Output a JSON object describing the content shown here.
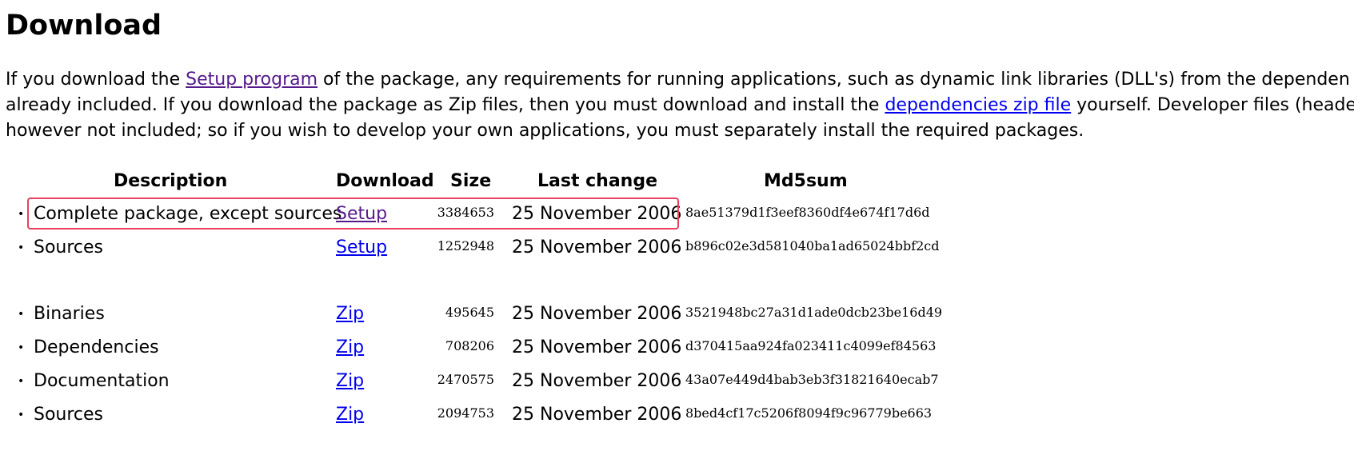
{
  "page": {
    "title": "Download",
    "intro": {
      "line1_before": "If you download the ",
      "setup_link": "Setup program",
      "line1_after": " of the package, any requirements for running applications, such as dynamic link libraries (DLL's) from the dependen",
      "line2_before": "already included. If you download the package as Zip files, then you must download and install the ",
      "deps_link": "dependencies zip file",
      "line2_after": " yourself. Developer files (heade",
      "line3": "however not included; so if you wish to develop your own applications, you must separately install the required packages."
    }
  },
  "table": {
    "headers": {
      "description": "Description",
      "download": "Download",
      "size": "Size",
      "last_change": "Last change",
      "md5sum": "Md5sum"
    },
    "bullet": "•",
    "rows": [
      {
        "description": "Complete package, except sources",
        "download": "Setup",
        "download_visited": true,
        "size": "3384653",
        "last_change": "25 November 2006",
        "md5sum": "8ae51379d1f3eef8360df4e674f17d6d",
        "highlighted": true
      },
      {
        "description": "Sources",
        "download": "Setup",
        "download_visited": false,
        "size": "1252948",
        "last_change": "25 November 2006",
        "md5sum": "b896c02e3d581040ba1ad65024bbf2cd",
        "highlighted": false
      },
      {
        "description": "Binaries",
        "download": "Zip",
        "download_visited": false,
        "size": "495645",
        "last_change": "25 November 2006",
        "md5sum": "3521948bc27a31d1ade0dcb23be16d49",
        "highlighted": false
      },
      {
        "description": "Dependencies",
        "download": "Zip",
        "download_visited": false,
        "size": "708206",
        "last_change": "25 November 2006",
        "md5sum": "d370415aa924fa023411c4099ef84563",
        "highlighted": false
      },
      {
        "description": "Documentation",
        "download": "Zip",
        "download_visited": false,
        "size": "2470575",
        "last_change": "25 November 2006",
        "md5sum": "43a07e449d4bab3eb3f31821640ecab7",
        "highlighted": false
      },
      {
        "description": "Sources",
        "download": "Zip",
        "download_visited": false,
        "size": "2094753",
        "last_change": "25 November 2006",
        "md5sum": "8bed4cf17c5206f8094f9c96779be663",
        "highlighted": false
      }
    ]
  },
  "colors": {
    "link": "#0000ee",
    "visited_link": "#551a8b",
    "highlight_border": "#e8415e"
  }
}
